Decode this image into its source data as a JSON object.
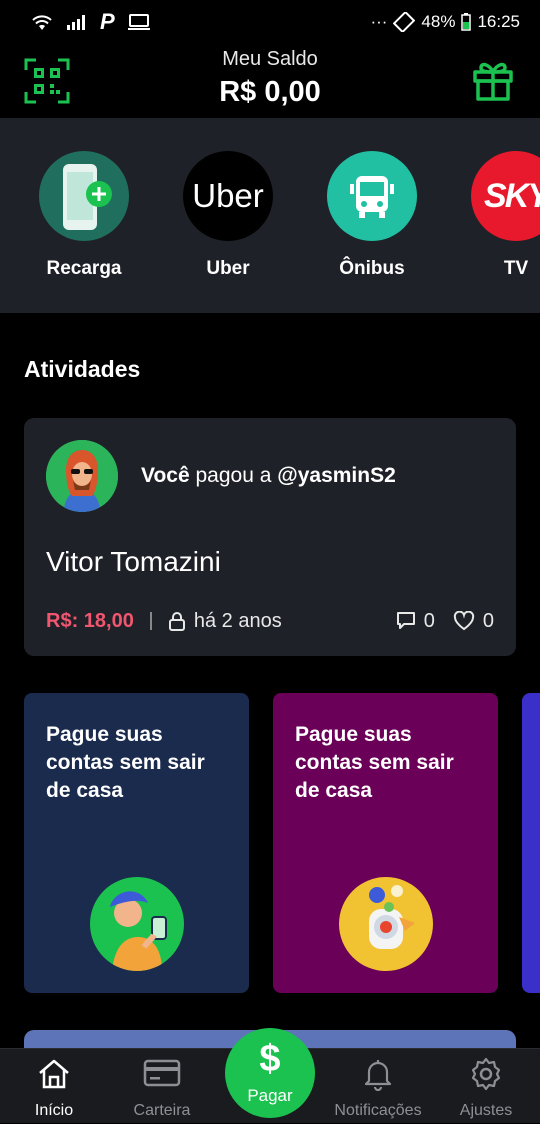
{
  "status_bar": {
    "battery": "48%",
    "time": "16:25",
    "dots": "···"
  },
  "header": {
    "balance_label": "Meu Saldo",
    "balance_value": "R$ 0,00"
  },
  "services": [
    {
      "label": "Recarga",
      "icon": "phone-plus-icon",
      "color": "#1f6e5e"
    },
    {
      "label": "Uber",
      "icon": "uber-logo",
      "logo_text": "Uber",
      "color": "#000000"
    },
    {
      "label": "Ônibus",
      "icon": "bus-icon",
      "color": "#22c0a3"
    },
    {
      "label": "TV",
      "icon": "sky-logo",
      "logo_text": "SKY",
      "color": "#e8192c"
    }
  ],
  "activities": {
    "title": "Atividades",
    "items": [
      {
        "actor": "Você",
        "verb": "pagou a",
        "target": "@yasminS2",
        "note": "Vitor Tomazini",
        "amount": "R$: 18,00",
        "time": "há 2 anos",
        "comments": "0",
        "likes": "0"
      }
    ]
  },
  "promos": [
    {
      "title": "Pague suas contas sem sair de casa",
      "color": "#1b2b4e",
      "image_bg": "#1bc24f"
    },
    {
      "title": "Pague suas contas sem sair de casa",
      "color": "#6b0058",
      "image_bg": "#f1c232"
    }
  ],
  "tabbar": {
    "tabs": [
      {
        "label": "Início",
        "icon": "home-icon",
        "active": true
      },
      {
        "label": "Carteira",
        "icon": "wallet-card-icon",
        "active": false
      },
      {
        "label": "Notificações",
        "icon": "bell-icon",
        "active": false
      },
      {
        "label": "Ajustes",
        "icon": "gear-icon",
        "active": false
      }
    ],
    "pay_symbol": "$",
    "pay_label": "Pagar"
  },
  "colors": {
    "brand_green": "#1bc24f",
    "amount_red": "#f0566f",
    "card_bg": "#1f2128"
  }
}
